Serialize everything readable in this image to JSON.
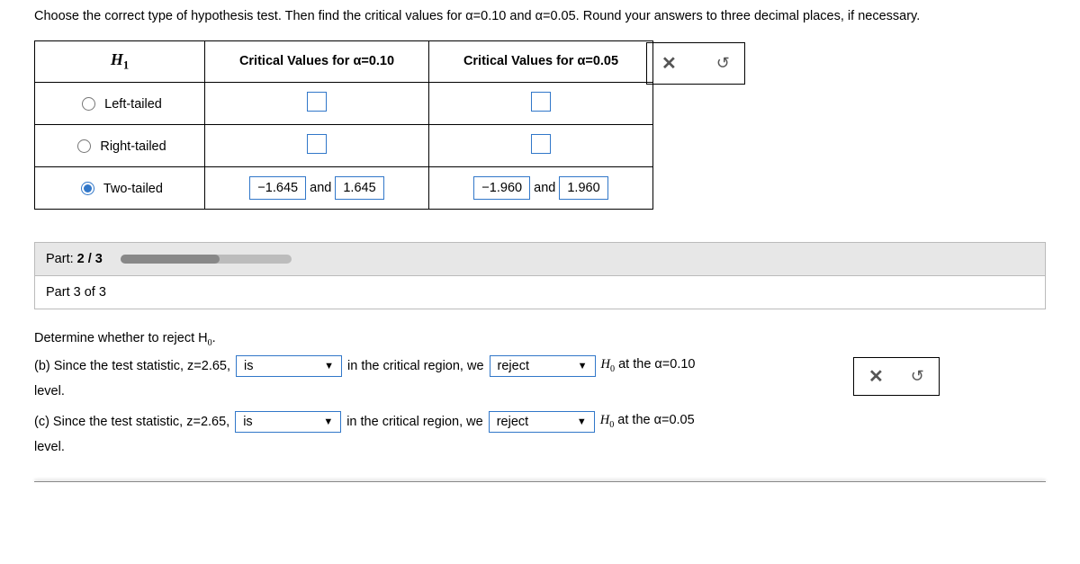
{
  "intro": "Choose the correct type of hypothesis test. Then find the critical values for α=0.10 and α=0.05. Round your answers to three decimal places, if necessary.",
  "table": {
    "h1": "H",
    "h1sub": "1",
    "col010": "Critical Values for α=0.10",
    "col005": "Critical Values for α=0.05",
    "rows": {
      "left": {
        "label": "Left-tailed",
        "checked": false
      },
      "right": {
        "label": "Right-tailed",
        "checked": false
      },
      "two": {
        "label": "Two-tailed",
        "checked": true,
        "v010a": "−1.645",
        "v010b": "1.645",
        "v005a": "−1.960",
        "v005b": "1.960",
        "and": "and"
      }
    }
  },
  "icons": {
    "close": "✕",
    "reset": "↺",
    "tri": "▼"
  },
  "partbar": {
    "label": "Part:",
    "pos": "2 / 3"
  },
  "part3": {
    "title": "Part 3 of 3"
  },
  "determine": "Determine whether to reject H",
  "determine_sub": "0",
  "period": ".",
  "b": {
    "lead": "(b) Since the test statistic, z=2.65,",
    "sel1": "is",
    "mid": "in the critical region, we",
    "sel2": "reject",
    "tail1": "H",
    "tail1sub": "0",
    "tail2": " at the α=0.10",
    "lvl": "level."
  },
  "c": {
    "lead": "(c) Since the test statistic, z=2.65,",
    "sel1": "is",
    "mid": "in the critical region, we",
    "sel2": "reject",
    "tail1": "H",
    "tail1sub": "0",
    "tail2": " at the α=0.05",
    "lvl": "level."
  }
}
